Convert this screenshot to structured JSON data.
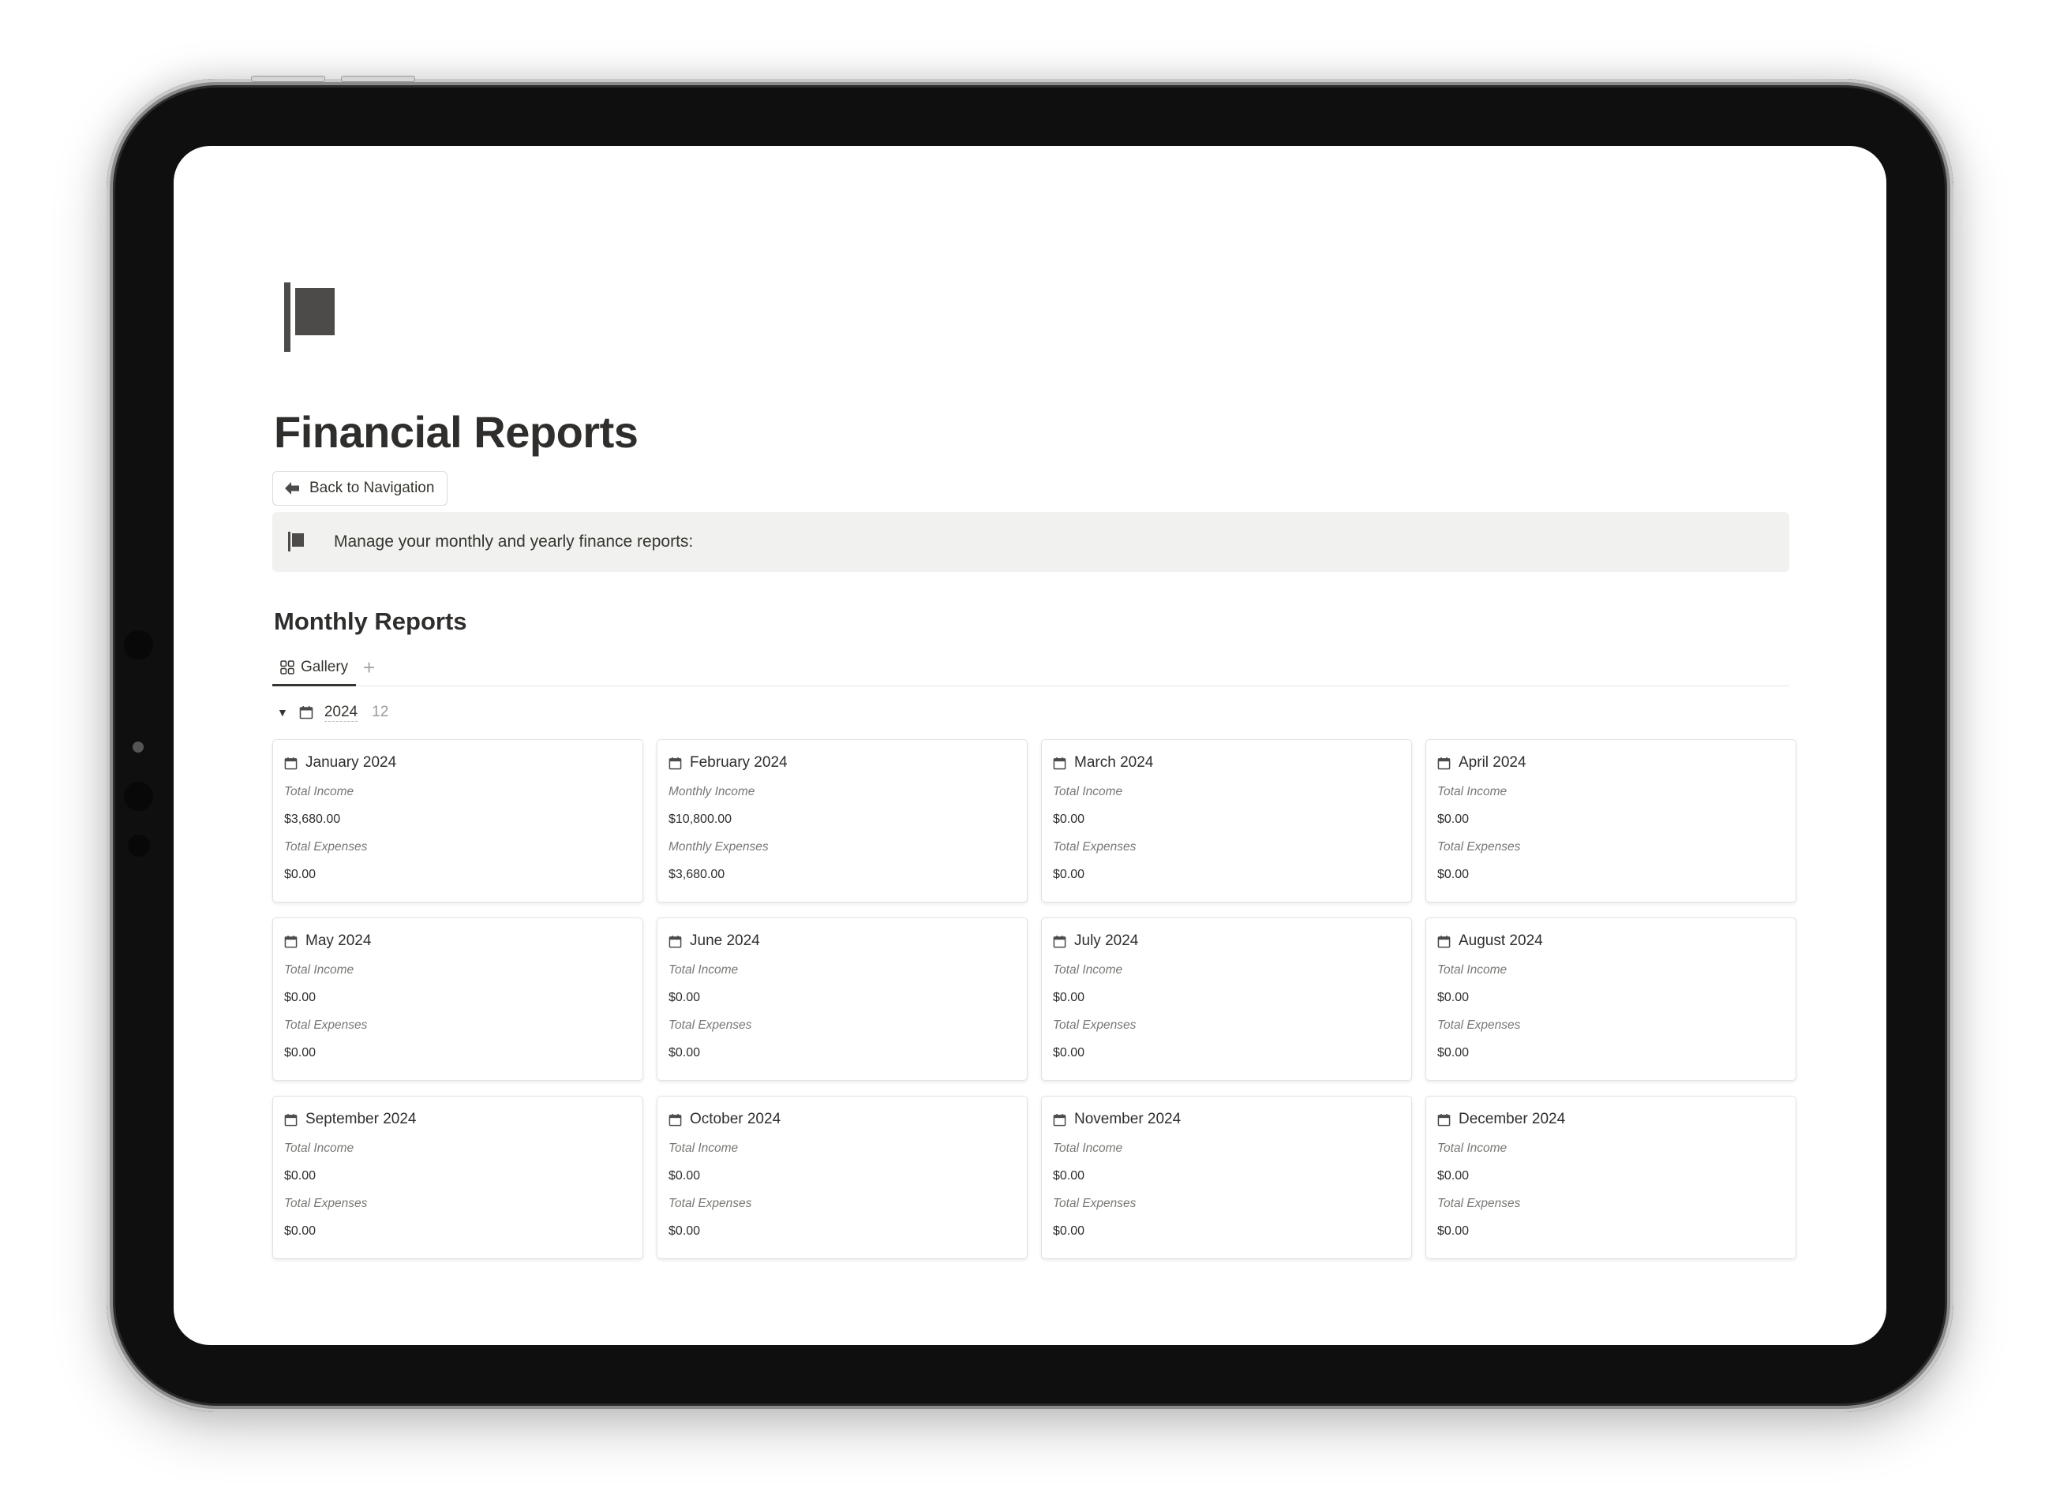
{
  "page": {
    "icon": "flag-icon",
    "title": "Financial Reports",
    "back_button": {
      "label": "Back to Navigation",
      "icon": "arrow-left-icon"
    },
    "callout": {
      "icon": "flag-icon",
      "text": "Manage your monthly and yearly finance reports:"
    }
  },
  "database": {
    "title": "Monthly Reports",
    "views": [
      {
        "label": "Gallery",
        "icon": "gallery-grid-icon",
        "active": true
      }
    ],
    "add_view_label": "+",
    "group": {
      "toggle": "▼",
      "icon": "calendar-icon",
      "name": "2024",
      "count": "12"
    },
    "cards": [
      {
        "title": "January 2024",
        "label1": "Total Income",
        "value1": "$3,680.00",
        "label2": "Total Expenses",
        "value2": "$0.00"
      },
      {
        "title": "February 2024",
        "label1": "Monthly Income",
        "value1": "$10,800.00",
        "label2": "Monthly Expenses",
        "value2": "$3,680.00"
      },
      {
        "title": "March 2024",
        "label1": "Total Income",
        "value1": "$0.00",
        "label2": "Total Expenses",
        "value2": "$0.00"
      },
      {
        "title": "April 2024",
        "label1": "Total Income",
        "value1": "$0.00",
        "label2": "Total Expenses",
        "value2": "$0.00"
      },
      {
        "title": "May 2024",
        "label1": "Total Income",
        "value1": "$0.00",
        "label2": "Total Expenses",
        "value2": "$0.00"
      },
      {
        "title": "June 2024",
        "label1": "Total Income",
        "value1": "$0.00",
        "label2": "Total Expenses",
        "value2": "$0.00"
      },
      {
        "title": "July 2024",
        "label1": "Total Income",
        "value1": "$0.00",
        "label2": "Total Expenses",
        "value2": "$0.00"
      },
      {
        "title": "August 2024",
        "label1": "Total Income",
        "value1": "$0.00",
        "label2": "Total Expenses",
        "value2": "$0.00"
      },
      {
        "title": "September 2024",
        "label1": "Total Income",
        "value1": "$0.00",
        "label2": "Total Expenses",
        "value2": "$0.00"
      },
      {
        "title": "October 2024",
        "label1": "Total Income",
        "value1": "$0.00",
        "label2": "Total Expenses",
        "value2": "$0.00"
      },
      {
        "title": "November 2024",
        "label1": "Total Income",
        "value1": "$0.00",
        "label2": "Total Expenses",
        "value2": "$0.00"
      },
      {
        "title": "December 2024",
        "label1": "Total Income",
        "value1": "$0.00",
        "label2": "Total Expenses",
        "value2": "$0.00"
      }
    ]
  }
}
